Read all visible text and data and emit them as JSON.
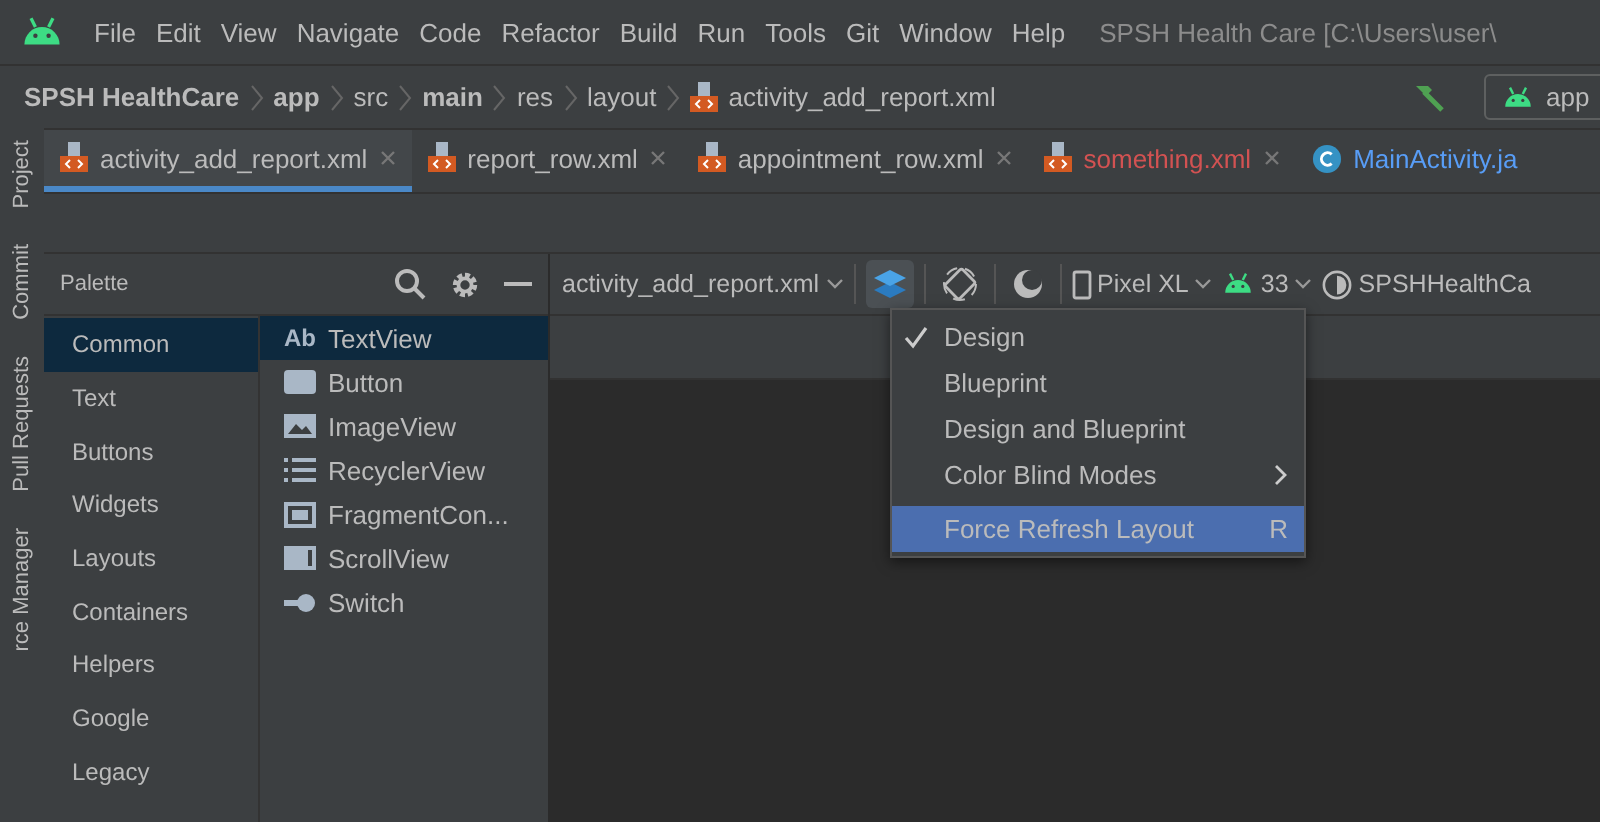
{
  "menu_bar": {
    "items": [
      "File",
      "Edit",
      "View",
      "Navigate",
      "Code",
      "Refactor",
      "Build",
      "Run",
      "Tools",
      "Git",
      "Window",
      "Help"
    ],
    "title": "SPSH Health Care [C:\\Users\\user\\"
  },
  "breadcrumb": {
    "items": [
      {
        "label": "SPSH HealthCare",
        "bold": true
      },
      {
        "label": "app",
        "bold": true
      },
      {
        "label": "src",
        "bold": false
      },
      {
        "label": "main",
        "bold": true
      },
      {
        "label": "res",
        "bold": false
      },
      {
        "label": "layout",
        "bold": false
      }
    ],
    "file": "activity_add_report.xml",
    "run_config": "app"
  },
  "tabs": [
    {
      "label": "activity_add_report.xml",
      "kind": "xml",
      "selected": true,
      "color": "#bbbbbb"
    },
    {
      "label": "report_row.xml",
      "kind": "xml",
      "selected": false,
      "color": "#bbbbbb"
    },
    {
      "label": "appointment_row.xml",
      "kind": "xml",
      "selected": false,
      "color": "#bbbbbb"
    },
    {
      "label": "something.xml",
      "kind": "xml",
      "selected": false,
      "color": "#d25252"
    },
    {
      "label": "MainActivity.ja",
      "kind": "class",
      "selected": false,
      "color": "#589df6"
    }
  ],
  "tool_stripe": [
    "Project",
    "Commit",
    "Pull Requests",
    "rce Manager"
  ],
  "palette": {
    "title": "Palette",
    "categories": [
      {
        "label": "Common",
        "selected": true
      },
      {
        "label": "Text",
        "selected": false
      },
      {
        "label": "Buttons",
        "selected": false
      },
      {
        "label": "Widgets",
        "selected": false
      },
      {
        "label": "Layouts",
        "selected": false
      },
      {
        "label": "Containers",
        "selected": false
      },
      {
        "label": "Helpers",
        "selected": false
      },
      {
        "label": "Google",
        "selected": false
      },
      {
        "label": "Legacy",
        "selected": false
      }
    ],
    "components": [
      {
        "label": "TextView",
        "kind": "text",
        "icon_text": "Ab",
        "selected": true
      },
      {
        "label": "Button",
        "kind": "button",
        "selected": false
      },
      {
        "label": "ImageView",
        "kind": "image",
        "selected": false
      },
      {
        "label": "RecyclerView",
        "kind": "list",
        "selected": false
      },
      {
        "label": "FragmentCon...",
        "kind": "fragment",
        "selected": false
      },
      {
        "label": "ScrollView",
        "kind": "scroll",
        "selected": false
      },
      {
        "label": "Switch",
        "kind": "switch",
        "selected": false
      }
    ]
  },
  "design_toolbar": {
    "file": "activity_add_report.xml",
    "device": "Pixel XL",
    "api": "33",
    "theme": "SPSHHealthCa"
  },
  "view_menu": {
    "items": [
      {
        "label": "Design",
        "checked": true,
        "selected": false,
        "submenu": false
      },
      {
        "label": "Blueprint",
        "checked": false,
        "selected": false,
        "submenu": false
      },
      {
        "label": "Design and Blueprint",
        "checked": false,
        "selected": false,
        "submenu": false
      },
      {
        "label": "Color Blind Modes",
        "checked": false,
        "selected": false,
        "submenu": true
      },
      {
        "label": "Force Refresh Layout",
        "checked": false,
        "selected": true,
        "submenu": false,
        "shortcut": "R"
      }
    ]
  }
}
